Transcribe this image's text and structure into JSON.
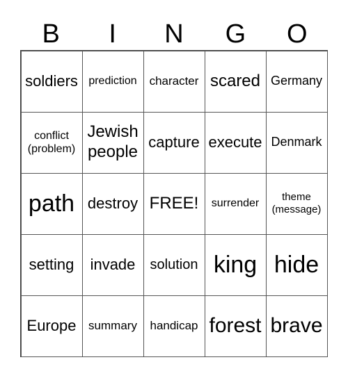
{
  "header": {
    "letters": [
      "B",
      "I",
      "N",
      "G",
      "O"
    ]
  },
  "cells": [
    "soldiers",
    "prediction",
    "character",
    "scared",
    "Germany",
    "conflict\n(problem)",
    "Jewish\npeople",
    "capture",
    "execute",
    "Denmark",
    "path",
    "destroy",
    "FREE!",
    "surrender",
    "theme\n(message)",
    "setting",
    "invade",
    "solution",
    "king",
    "hide",
    "Europe",
    "summary",
    "handicap",
    "forest",
    "brave"
  ]
}
